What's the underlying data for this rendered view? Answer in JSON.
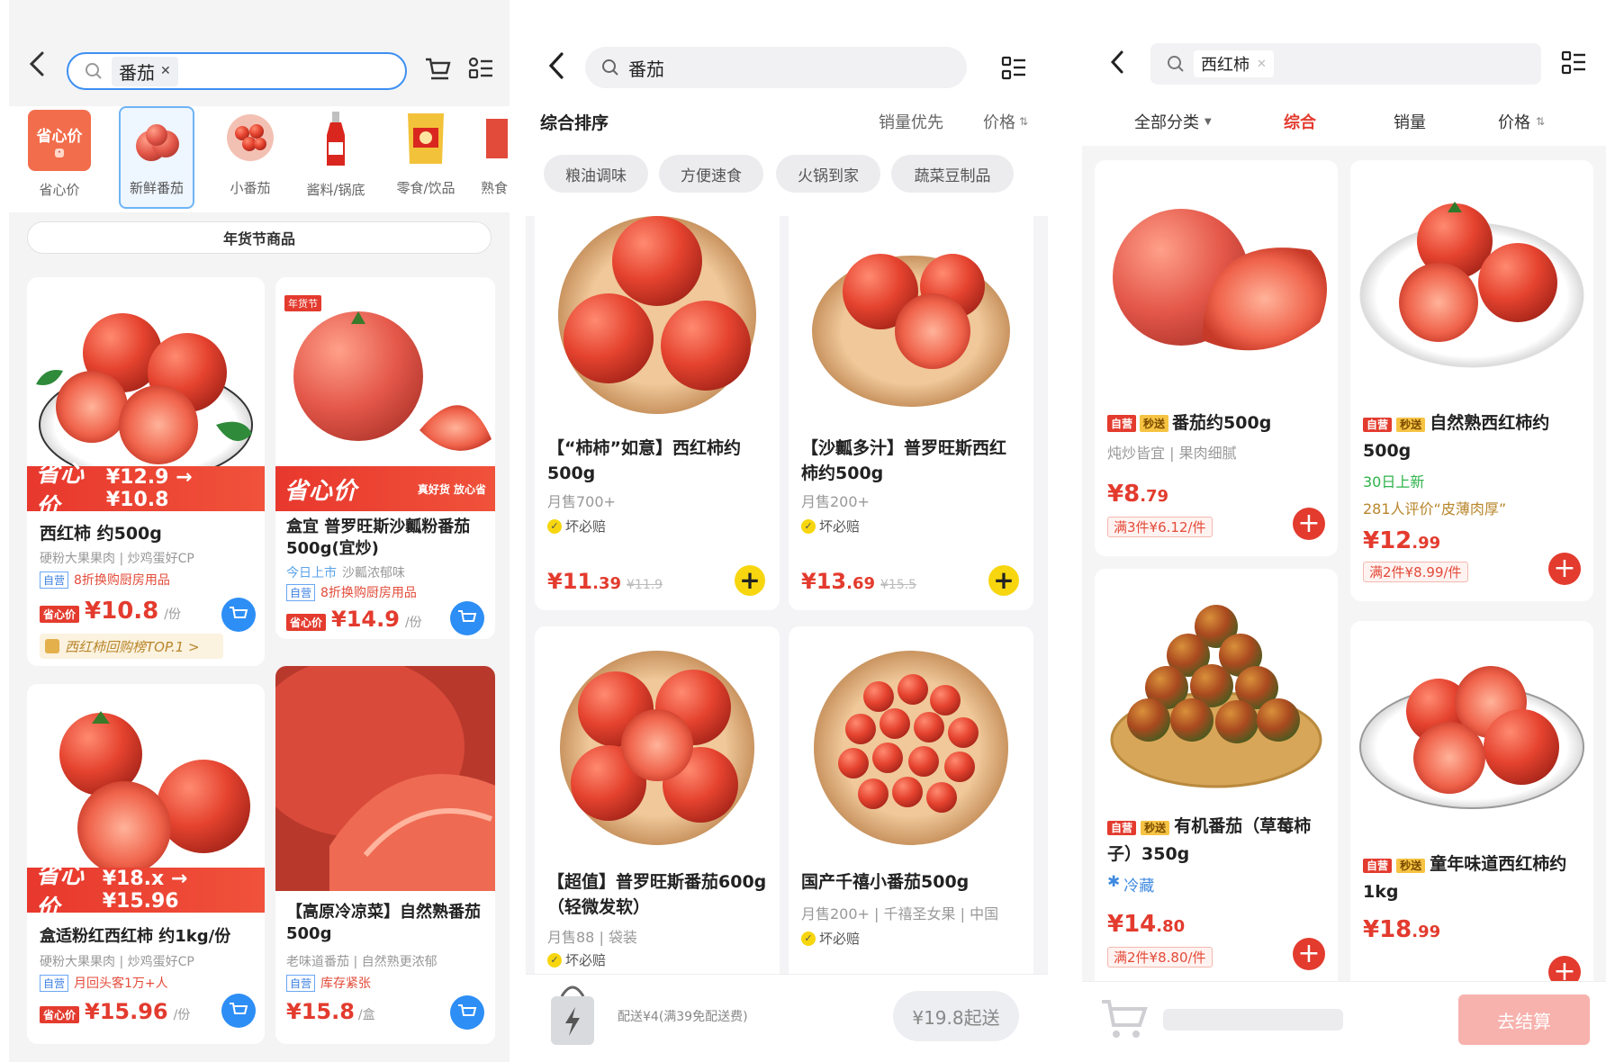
{
  "p1": {
    "search_query": "番茄",
    "categories": [
      {
        "label": "省心价"
      },
      {
        "label": "新鲜番茄"
      },
      {
        "label": "小番茄"
      },
      {
        "label": "酱料/锅底"
      },
      {
        "label": "零食/饮品"
      },
      {
        "label": "熟食"
      }
    ],
    "cat0_badge": "省心价",
    "banner": "年货节商品",
    "products": [
      {
        "bar_label": "省心价",
        "bar_compare": "¥12.9 → ¥10.8",
        "title": "西红柿 约500g",
        "desc": "硬粉大果果肉 | 炒鸡蛋好CP",
        "tag": "自营",
        "promo": "8折换购厨房用品",
        "price_badge": "省心价",
        "price": "¥10.8",
        "unit": "/份",
        "rank": "西红柿回购榜TOP.1 >"
      },
      {
        "corner": "年货节",
        "bar_label": "省心价",
        "bar_right": "真好货 放心省",
        "title": "盒宜 普罗旺斯沙瓤粉番茄500g(宜炒)",
        "sub_green": "今日上市",
        "desc": "沙瓤浓郁味",
        "tag": "自营",
        "promo": "8折换购厨房用品",
        "price_badge": "省心价",
        "price": "¥14.9",
        "unit": "/份"
      },
      {
        "bar_label": "省心价",
        "bar_compare": "¥18.x → ¥15.96",
        "title": "盒适粉红西红柿 约1kg/份",
        "desc": "硬粉大果果肉 | 炒鸡蛋好CP",
        "tag": "自营",
        "promo": "月回头客1万+人",
        "price_badge": "省心价",
        "price": "¥15.96",
        "unit": "/份"
      },
      {
        "title": "【高原冷凉菜】自然熟番茄500g",
        "desc": "老味道番茄 | 自然熟更浓郁",
        "tag": "自营",
        "promo": "库存紧张",
        "price": "¥15.8",
        "unit": "/盒"
      }
    ],
    "colors": {
      "accent": "#e33b2e",
      "cart": "#2d8ef5"
    }
  },
  "p2": {
    "search_query": "番茄",
    "sort_default": "综合排序",
    "sort_sales": "销量优先",
    "sort_price": "价格",
    "chips": [
      "粮油调味",
      "方便速食",
      "火锅到家",
      "蔬菜豆制品"
    ],
    "products": [
      {
        "title": "【“柿柿”如意】西红柿约500g",
        "sales": "月售700+",
        "guarantee": "坏必赔",
        "price_int": "¥11",
        "price_dec": ".39",
        "orig": "¥11.9"
      },
      {
        "title": "【沙瓤多汁】普罗旺斯西红柿约500g",
        "sales": "月售200+",
        "guarantee": "坏必赔",
        "price_int": "¥13",
        "price_dec": ".69",
        "orig": "¥15.5"
      },
      {
        "title": "【超值】普罗旺斯番茄600g（轻微发软）",
        "sales": "月售88 | 袋装",
        "guarantee": "坏必赔"
      },
      {
        "title": "国产千禧小番茄500g",
        "sales": "月售200+ | 千禧圣女果 | 中国",
        "guarantee": "坏必赔"
      }
    ],
    "footer_delivery": "配送¥4(满39免配送费)",
    "footer_min": "¥19.8起送"
  },
  "p3": {
    "search_query": "西红柿",
    "filters": [
      "全部分类",
      "综合",
      "销量",
      "价格"
    ],
    "products": [
      {
        "tag1": "自营",
        "tag2": "秒送",
        "title": "番茄约500g",
        "desc": "炖炒皆宜 | 果肉细腻",
        "price_int": "¥8",
        "price_dec": ".79",
        "promo": "满3件¥6.12/件"
      },
      {
        "tag1": "自营",
        "tag2": "秒送",
        "title": "自然熟西红柿约500g",
        "new": "30日上新",
        "review": "281人评价“皮薄肉厚”",
        "price_int": "¥12",
        "price_dec": ".99",
        "promo": "满2件¥8.99/件"
      },
      {
        "tag1": "自营",
        "tag2": "秒送",
        "title": "有机番茄（草莓柿子）350g",
        "cold": "冷藏",
        "price_int": "¥14",
        "price_dec": ".80",
        "promo": "满2件¥8.80/件"
      },
      {
        "tag1": "自营",
        "tag2": "秒送",
        "title": "童年味道西红柿约1kg",
        "price_int": "¥18",
        "price_dec": ".99"
      }
    ],
    "checkout": "去结算"
  }
}
